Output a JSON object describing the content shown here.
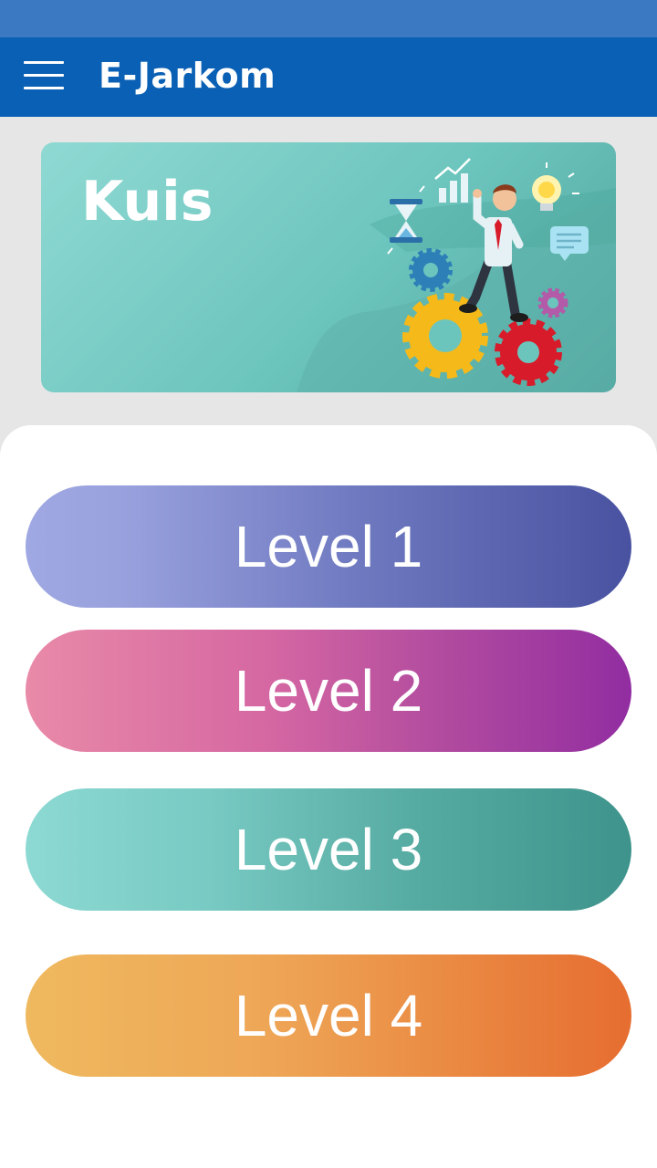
{
  "app_bar": {
    "title": "E-Jarkom",
    "menu_icon": "hamburger-menu-icon",
    "background_color": "#0a60b4",
    "status_bar_color": "#3b79c2"
  },
  "banner": {
    "title": "Kuis",
    "illustration": "businessman-on-gears-illustration"
  },
  "levels": [
    {
      "label": "Level 1"
    },
    {
      "label": "Level 2"
    },
    {
      "label": "Level 3"
    },
    {
      "label": "Level 4"
    }
  ]
}
